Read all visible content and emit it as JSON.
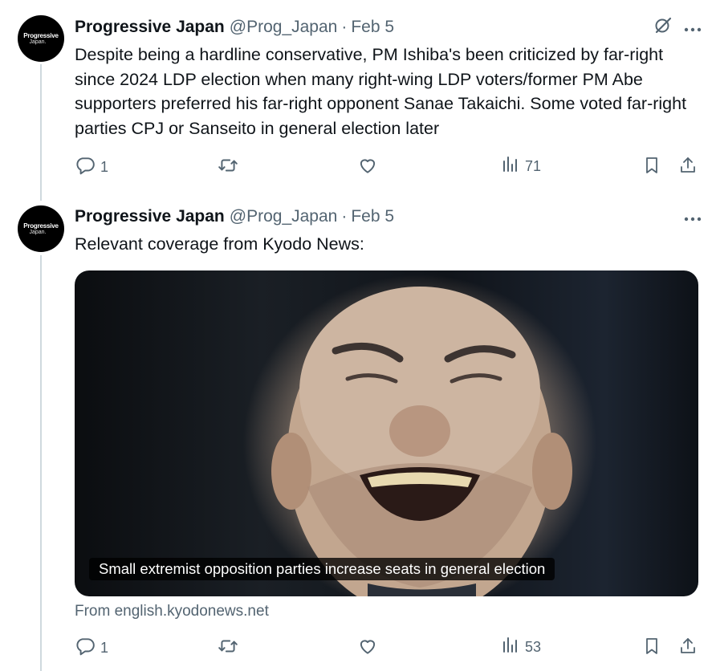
{
  "tweets": [
    {
      "avatar": {
        "line1": "Progressive",
        "line2": "Japan."
      },
      "name": "Progressive Japan",
      "handle": "@Prog_Japan",
      "separator": "·",
      "date": "Feb 5",
      "text": "Despite being a hardline conservative, PM Ishiba's been criticized by far-right since 2024 LDP election when many right-wing LDP voters/former PM Abe supporters preferred his far-right opponent Sanae Takaichi. Some voted far-right parties CPJ or Sanseito in general election later",
      "replies": "1",
      "views": "71"
    },
    {
      "avatar": {
        "line1": "Progressive",
        "line2": "Japan."
      },
      "name": "Progressive Japan",
      "handle": "@Prog_Japan",
      "separator": "·",
      "date": "Feb 5",
      "text": "Relevant coverage from Kyodo News:",
      "card": {
        "caption": "Small extremist opposition parties increase seats in general election",
        "from": "From english.kyodonews.net"
      },
      "replies": "1",
      "views": "53"
    }
  ],
  "icons": {
    "reply": "reply-icon",
    "retweet": "retweet-icon",
    "like": "like-icon",
    "views": "views-icon",
    "bookmark": "bookmark-icon",
    "share": "share-icon",
    "grok": "grok-icon",
    "more": "more-icon"
  },
  "colors": {
    "secondary_text": "#536471",
    "thread_line": "#cfd9de"
  }
}
